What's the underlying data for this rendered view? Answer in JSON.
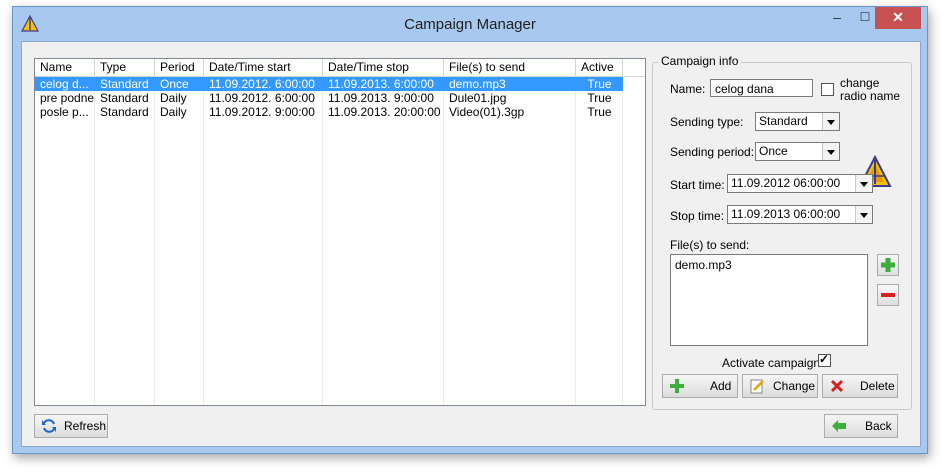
{
  "window": {
    "title": "Campaign Manager",
    "min_glyph": "–",
    "max_glyph": "☐",
    "close_glyph": "✕",
    "app_icon": "campaign-logo-icon"
  },
  "list": {
    "columns": [
      "Name",
      "Type",
      "Period",
      "Date/Time start",
      "Date/Time stop",
      "File(s) to send",
      "Active"
    ],
    "rows": [
      {
        "name": "celog d...",
        "type": "Standard",
        "period": "Once",
        "start": "11.09.2012. 6:00:00",
        "stop": "11.09.2013. 6:00:00",
        "files": "demo.mp3",
        "active": "True"
      },
      {
        "name": "pre podne",
        "type": "Standard",
        "period": "Daily",
        "start": "11.09.2012. 6:00:00",
        "stop": "11.09.2013. 9:00:00",
        "files": "Dule01.jpg",
        "active": "True"
      },
      {
        "name": "posle p...",
        "type": "Standard",
        "period": "Daily",
        "start": "11.09.2012. 9:00:00",
        "stop": "11.09.2013. 20:00:00",
        "files": "Video(01).3gp",
        "active": "True"
      }
    ],
    "selected_row": 0
  },
  "campaign_info": {
    "legend": "Campaign info",
    "name_label": "Name:",
    "name_value": "celog dana",
    "change_radio_label_1": "change",
    "change_radio_label_2": "radio name",
    "change_radio_checked": false,
    "sending_type_label": "Sending type:",
    "sending_type_value": "Standard",
    "sending_period_label": "Sending period:",
    "sending_period_value": "Once",
    "start_time_label": "Start time:",
    "start_time_value": "11.09.2012 06:00:00",
    "stop_time_label": "Stop time:",
    "stop_time_value": "11.09.2013 06:00:00",
    "files_label": "File(s) to send:",
    "files": [
      "demo.mp3"
    ],
    "activate_label": "Activate campaign",
    "activate_checked": true
  },
  "buttons": {
    "add": "Add",
    "change": "Change",
    "delete": "Delete",
    "refresh": "Refresh",
    "back": "Back"
  },
  "colors": {
    "selection": "#3399ff",
    "frame": "#a8c9ef",
    "close": "#c75050",
    "add_green": "#3cae3c",
    "delete_red": "#d82020"
  }
}
